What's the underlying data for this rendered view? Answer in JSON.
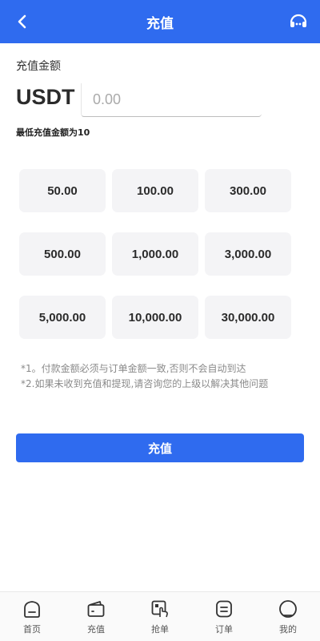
{
  "header": {
    "title": "充值",
    "back_icon": "chevron-left-icon",
    "support_icon": "headset-icon"
  },
  "amount": {
    "label": "充值金额",
    "currency": "USDT",
    "input_value": "",
    "input_placeholder": "0.00",
    "min_note": "最低充值金额为10"
  },
  "presets": [
    "50.00",
    "100.00",
    "300.00",
    "500.00",
    "1,000.00",
    "3,000.00",
    "5,000.00",
    "10,000.00",
    "30,000.00"
  ],
  "notes": [
    "*1。付款金额必须与订单金额一致,否则不会自动到达",
    "*2.如果未收到充值和提现,请咨询您的上级以解决其他问题"
  ],
  "submit_label": "充值",
  "nav": [
    {
      "label": "首页",
      "icon": "home-icon"
    },
    {
      "label": "充值",
      "icon": "wallet-icon"
    },
    {
      "label": "抢单",
      "icon": "grab-order-icon"
    },
    {
      "label": "订单",
      "icon": "order-icon"
    },
    {
      "label": "我的",
      "icon": "profile-icon"
    }
  ],
  "colors": {
    "primary": "#2f6bef",
    "preset_bg": "#f4f4f6",
    "note_text": "#8a8a8a"
  }
}
